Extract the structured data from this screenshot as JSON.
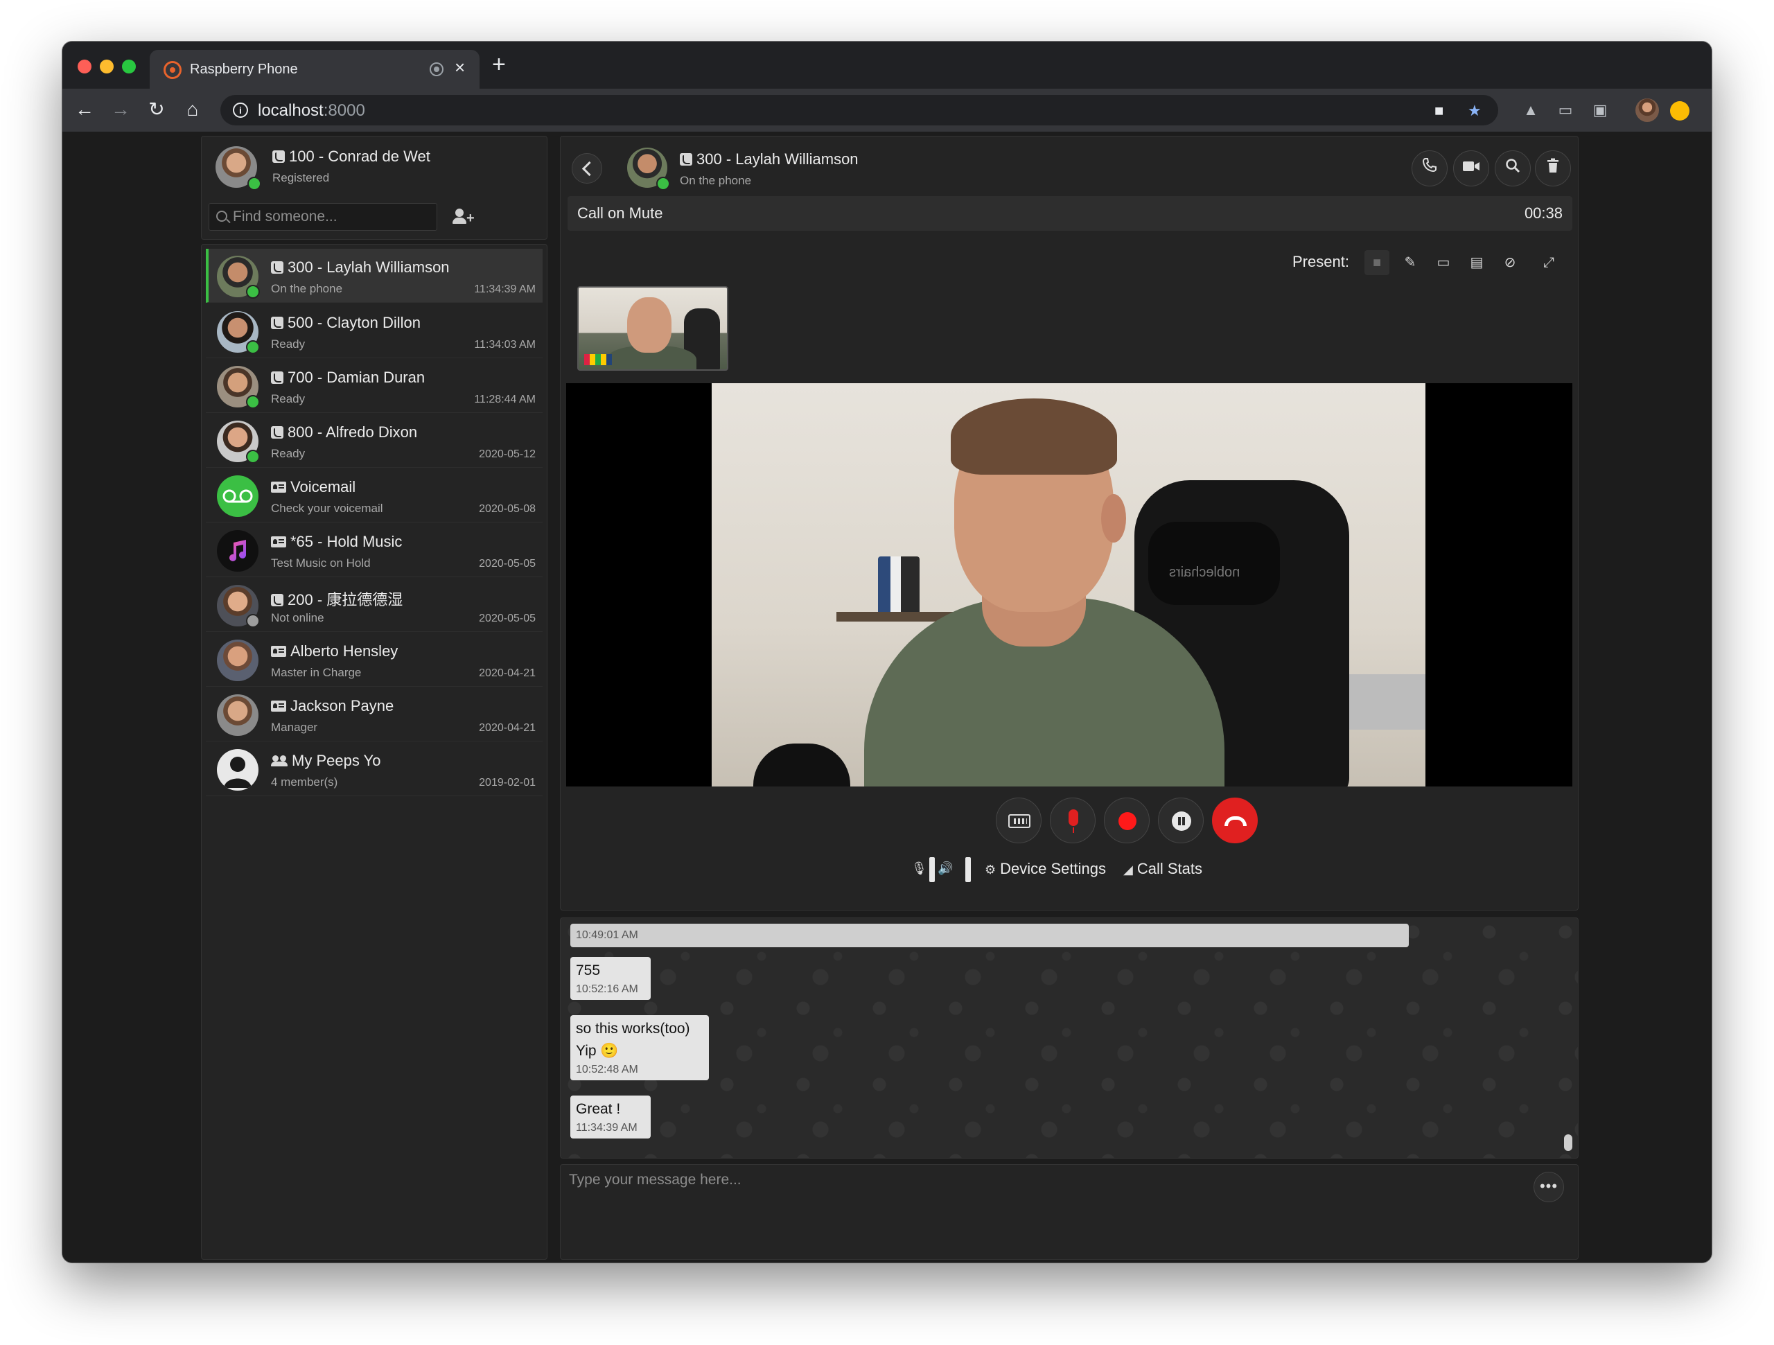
{
  "browser": {
    "tab_title": "Raspberry Phone",
    "tab_close": "×",
    "new_tab": "+",
    "url_host": "localhost",
    "url_port": ":8000",
    "icons": [
      "back-icon",
      "forward-icon",
      "reload-icon",
      "home-icon",
      "camera-icon",
      "star-icon",
      "drive-icon",
      "cast-icon",
      "screenshot-icon"
    ]
  },
  "me": {
    "name": "100 - Conrad de Wet",
    "status": "Registered"
  },
  "search": {
    "placeholder": "Find someone..."
  },
  "contacts": [
    {
      "icon": "phone",
      "name": "300 - Laylah Williamson",
      "sub": "On the phone",
      "time": "11:34:39 AM",
      "status": "green",
      "active": true
    },
    {
      "icon": "phone",
      "name": "500 - Clayton Dillon",
      "sub": "Ready",
      "time": "11:34:03 AM",
      "status": "green"
    },
    {
      "icon": "phone",
      "name": "700 - Damian Duran",
      "sub": "Ready",
      "time": "11:28:44 AM",
      "status": "green"
    },
    {
      "icon": "phone",
      "name": "800 - Alfredo Dixon",
      "sub": "Ready",
      "time": "2020-05-12",
      "status": "green"
    },
    {
      "icon": "card",
      "name": "Voicemail",
      "sub": "Check your voicemail",
      "time": "2020-05-08"
    },
    {
      "icon": "card",
      "name": "*65 - Hold Music",
      "sub": "Test Music on Hold",
      "time": "2020-05-05"
    },
    {
      "icon": "phone",
      "name": "200 - 康拉德德湿",
      "sub": "Not online",
      "time": "2020-05-05",
      "status": "grey"
    },
    {
      "icon": "card",
      "name": "Alberto Hensley",
      "sub": "Master in Charge",
      "time": "2020-04-21"
    },
    {
      "icon": "card",
      "name": "Jackson Payne",
      "sub": "Manager",
      "time": "2020-04-21"
    },
    {
      "icon": "group",
      "name": "My Peeps Yo",
      "sub": "4 member(s)",
      "time": "2019-02-01"
    }
  ],
  "call": {
    "name": "300 - Laylah Williamson",
    "status": "On the phone",
    "banner": "Call on Mute",
    "duration": "00:38",
    "present_label": "Present:",
    "device_settings": "Device Settings",
    "call_stats": "Call Stats",
    "remote_logo_text": "noblechairs"
  },
  "chat": {
    "messages": [
      {
        "text": "",
        "time": "10:49:01 AM"
      },
      {
        "text": "755",
        "time": "10:52:16 AM"
      },
      {
        "text": "so this works(too)",
        "text2": "Yip 🙂",
        "time": "10:52:48 AM"
      },
      {
        "text": "Great !",
        "time": "11:34:39 AM"
      }
    ],
    "placeholder": "Type your message here...",
    "more": "•••"
  },
  "colors": {
    "accent_green": "#3bbf44",
    "hangup_red": "#e02020",
    "record_red": "#ff1a1a"
  }
}
